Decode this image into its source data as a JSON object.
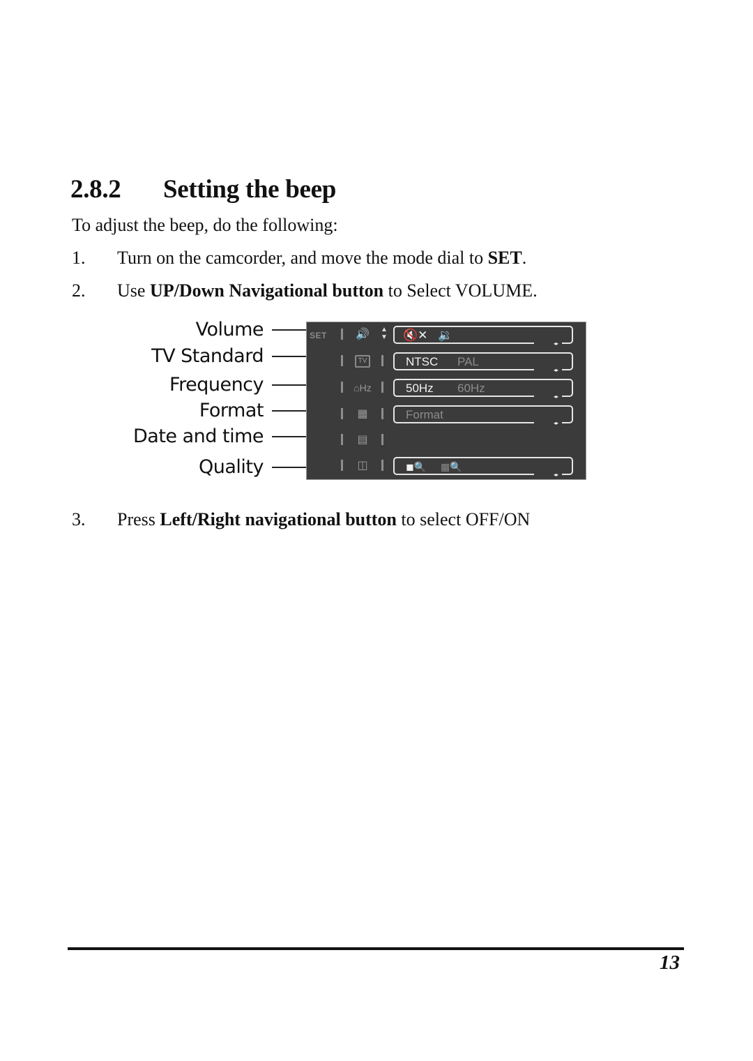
{
  "section": {
    "number": "2.8.2",
    "title": "Setting the beep"
  },
  "intro": "To adjust the beep, do the following:",
  "steps": [
    {
      "n": "1.",
      "pre": "Turn on the camcorder, and move the mode dial to ",
      "bold": "SET",
      "post": "."
    },
    {
      "n": "2.",
      "pre": "Use ",
      "bold": "UP/Down Navigational button",
      "post": " to Select VOLUME."
    },
    {
      "n": "3.",
      "pre": "Press ",
      "bold": "Left/Right navigational button",
      "post": " to select OFF/ON"
    }
  ],
  "figure": {
    "callouts": [
      "Volume",
      "TV Standard",
      "Frequency",
      "Format",
      "Date and time",
      "Quality"
    ],
    "set_tab": "SET",
    "rows": [
      {
        "icon": "volume-icon",
        "glyph": "🔊",
        "options": [
          "mute-icon",
          "speaker-icon"
        ],
        "option_glyphs": [
          "🔇✕",
          "🔉"
        ],
        "selected": 0
      },
      {
        "icon": "tv-icon",
        "glyph": "TV",
        "options": [
          "NTSC",
          "PAL"
        ],
        "selected": 0
      },
      {
        "icon": "frequency-icon",
        "glyph": "⌂Hz",
        "options": [
          "50Hz",
          "60Hz"
        ],
        "selected": 0
      },
      {
        "icon": "format-icon",
        "glyph": "▦",
        "options": [
          "Format"
        ],
        "selected": -1
      },
      {
        "icon": "date-time-icon",
        "glyph": "▤",
        "options": [],
        "selected": -1
      },
      {
        "icon": "quality-icon",
        "glyph": "◫",
        "options": [
          "high-quality-icon",
          "normal-quality-icon"
        ],
        "option_glyphs": [
          "◼🔍",
          "▦🔍"
        ],
        "selected": 0
      }
    ],
    "lr_arrows": "◂▸"
  },
  "footer": {
    "page_number": "13"
  }
}
